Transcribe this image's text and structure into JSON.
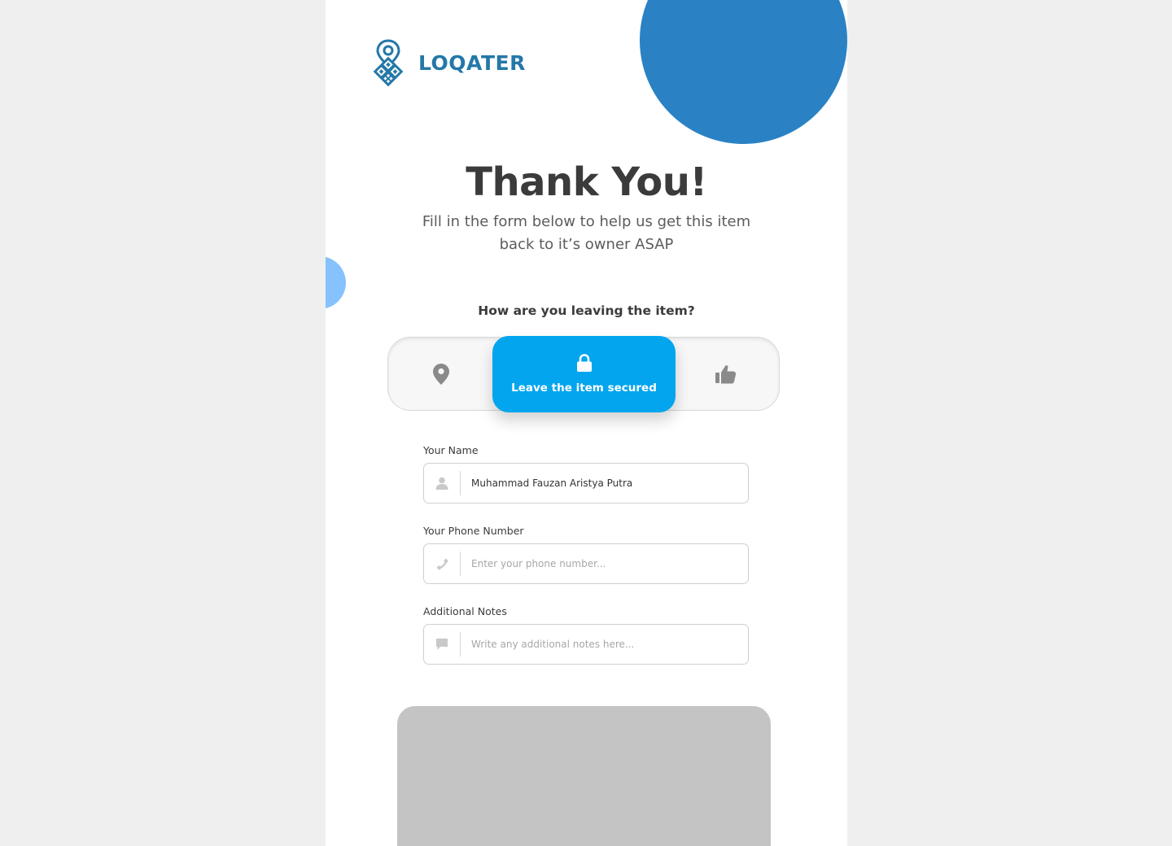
{
  "brand": {
    "name": "LOQATER",
    "logo_icon": "map-pin-qr-logo",
    "color": "#2478a8"
  },
  "colors": {
    "accent": "#03a5ef",
    "circle_large": "#2a82c4",
    "circle_small": "#86c2fd",
    "placeholder_card": "#c4c4c4"
  },
  "heading": {
    "title": "Thank You!",
    "subtitle_line1": "Fill in the form below to help us get this item",
    "subtitle_line2": "back to it’s owner ASAP"
  },
  "leave_options": {
    "question": "How are you leaving the item?",
    "options": [
      {
        "icon": "map-pin-icon",
        "label": "",
        "selected": false
      },
      {
        "icon": "lock-icon",
        "label": "Leave the item secured",
        "selected": true
      },
      {
        "icon": "thumbs-up-icon",
        "label": "",
        "selected": false
      }
    ]
  },
  "form": {
    "name": {
      "label": "Your Name",
      "icon": "user-icon",
      "value": "Muhammad Fauzan Aristya Putra",
      "placeholder": ""
    },
    "phone": {
      "label": "Your Phone Number",
      "icon": "phone-icon",
      "value": "",
      "placeholder": "Enter your phone number..."
    },
    "notes": {
      "label": "Additional Notes",
      "icon": "chat-bubble-icon",
      "value": "",
      "placeholder": "Write any additional notes here..."
    }
  }
}
